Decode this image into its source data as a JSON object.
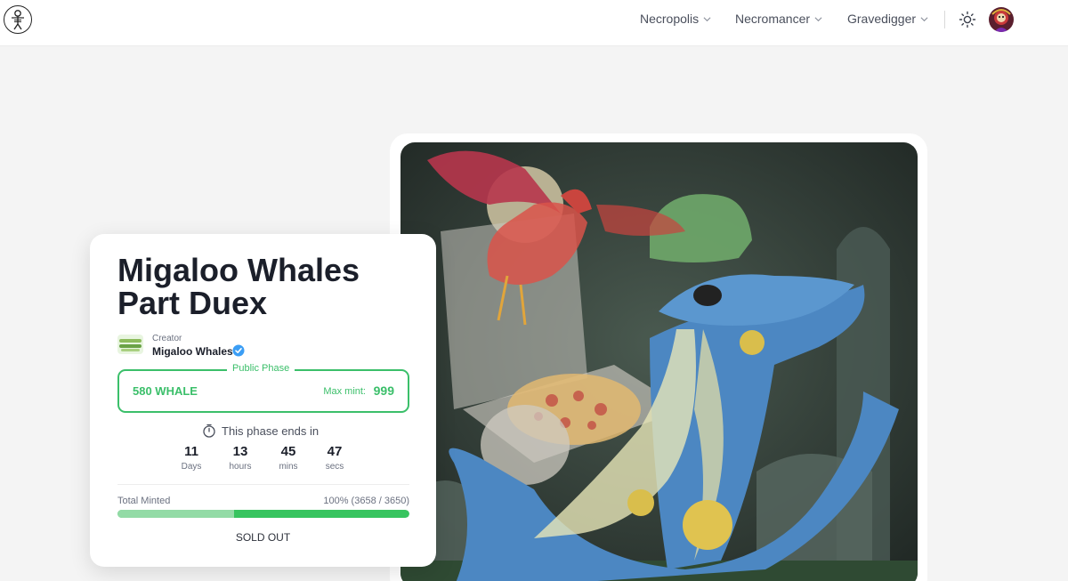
{
  "nav": {
    "items": [
      {
        "label": "Necropolis"
      },
      {
        "label": "Necromancer"
      },
      {
        "label": "Gravedigger"
      }
    ]
  },
  "icons": {
    "logo": "skeleton-logo-icon",
    "theme_toggle": "sun-icon",
    "avatar": "user-avatar",
    "verified": "verified-badge-icon",
    "timer": "stopwatch-icon",
    "dropdown": "chevron-down-icon"
  },
  "colors": {
    "accent_green": "#3bbf6a",
    "progress_green": "#37c45f",
    "progress_light": "#93dba6",
    "verified_blue": "#3b9ef5"
  },
  "collection": {
    "title": "Migaloo Whales Part Duex",
    "creator_label": "Creator",
    "creator_name": "Migaloo Whales"
  },
  "phase": {
    "label": "Public Phase",
    "price": "580 WHALE",
    "max_mint_label": "Max mint:",
    "max_mint_value": "999"
  },
  "countdown": {
    "ends_text": "This phase ends in",
    "days": "11",
    "days_unit": "Days",
    "hours": "13",
    "hours_unit": "hours",
    "mins": "45",
    "mins_unit": "mins",
    "secs": "47",
    "secs_unit": "secs"
  },
  "minted": {
    "label": "Total Minted",
    "value_text": "100% (3658 / 3650)",
    "progress_fraction": 1.0
  },
  "status": "SOLD OUT"
}
